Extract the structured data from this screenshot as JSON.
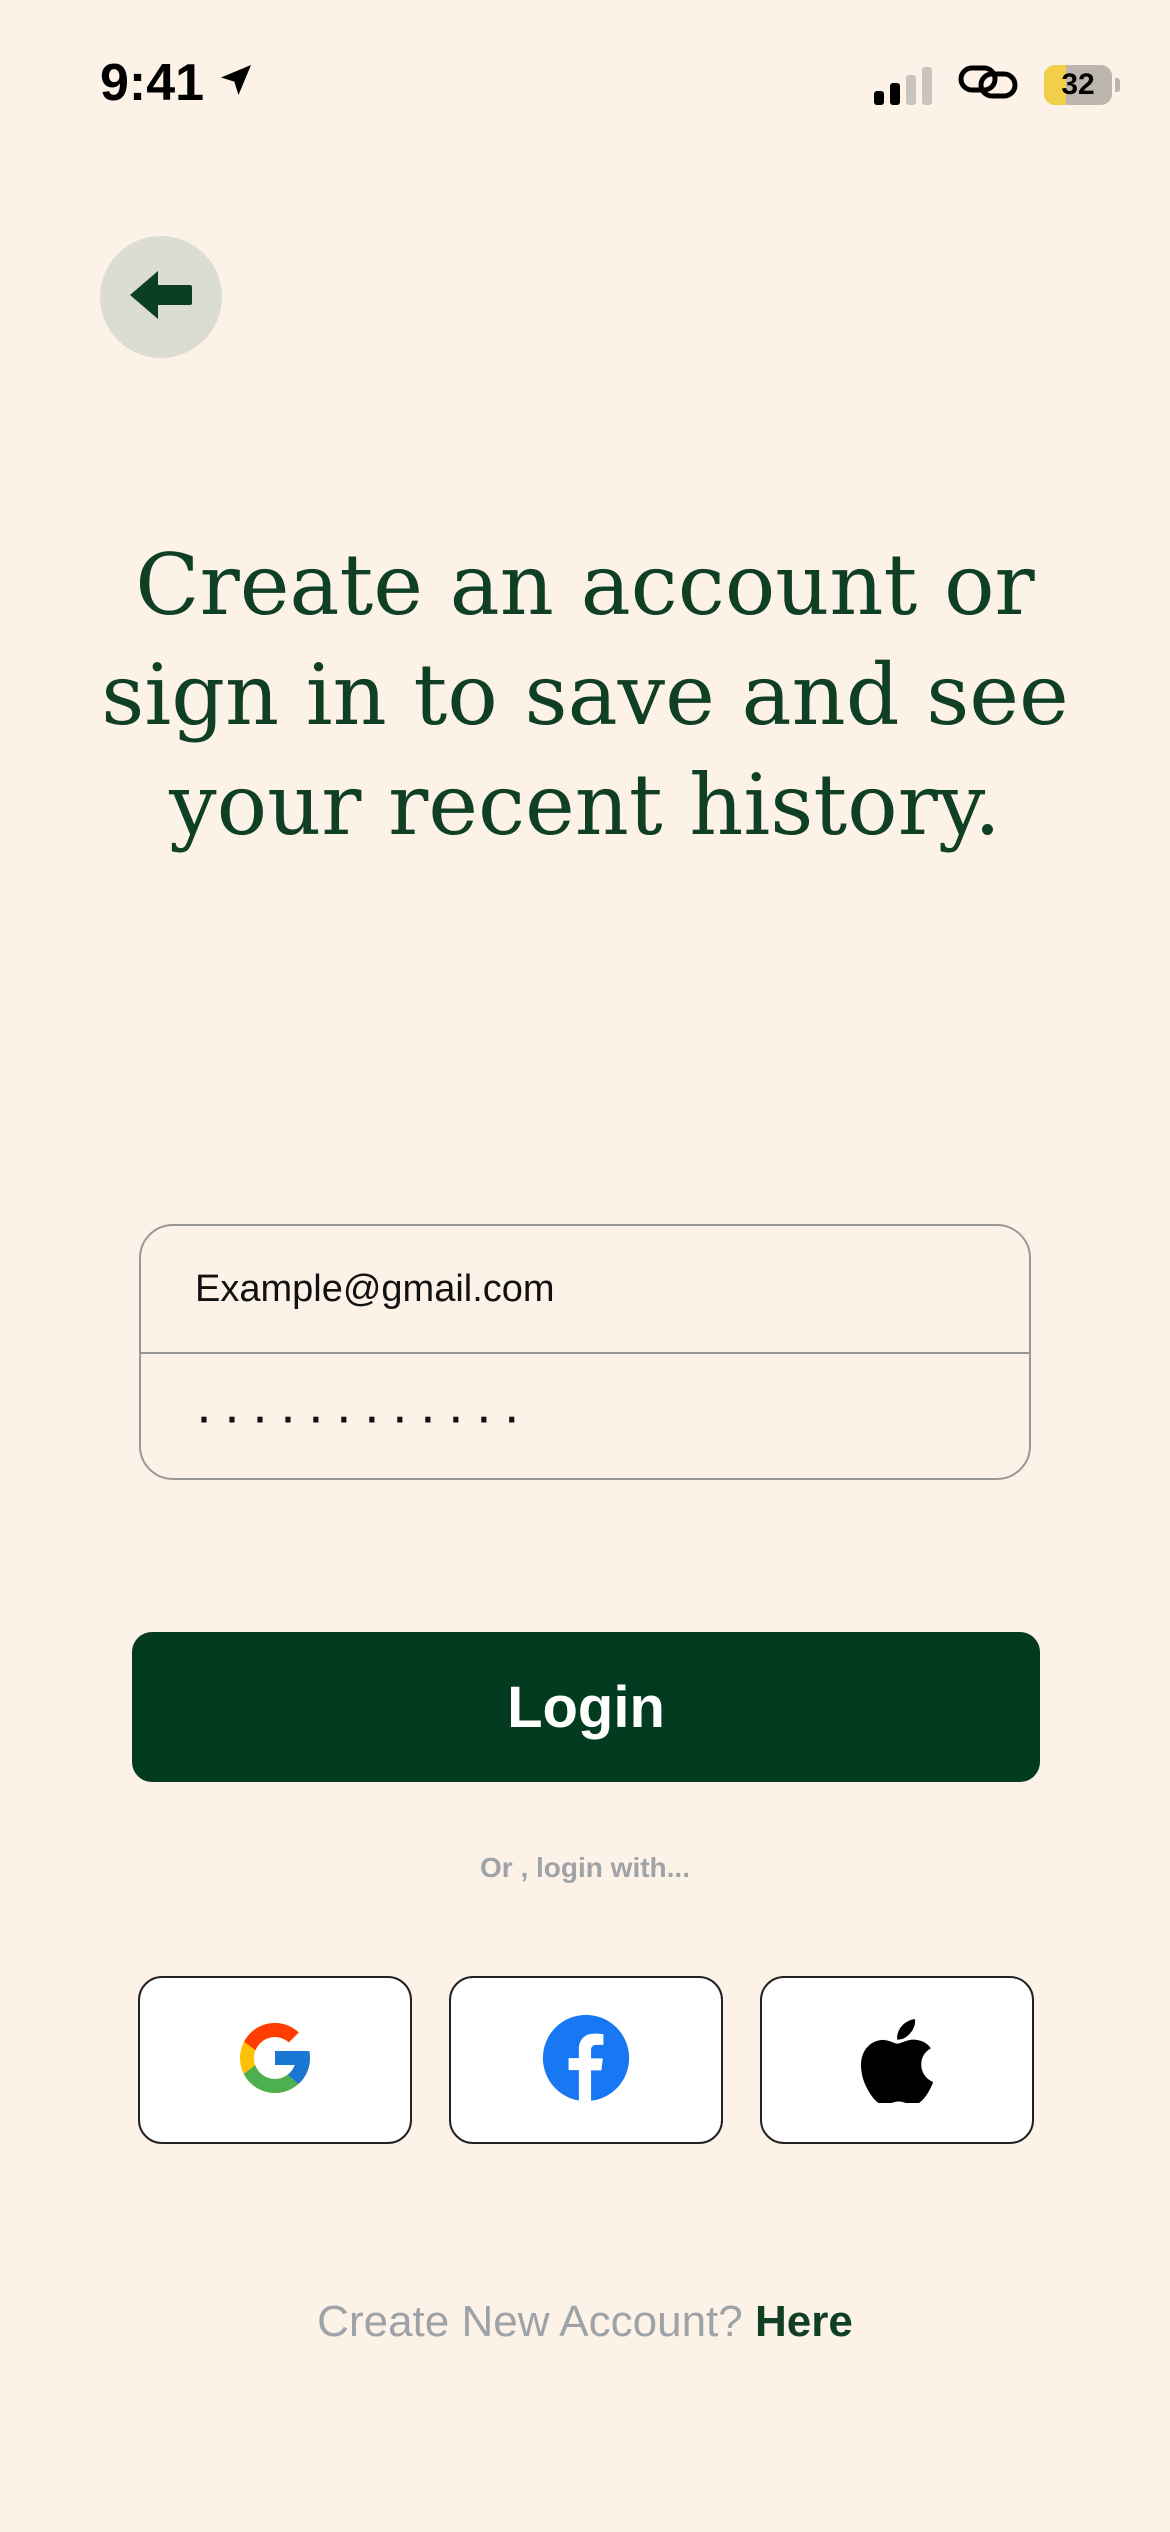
{
  "status_bar": {
    "time": "9:41",
    "battery_level": "32",
    "icons": [
      "location-arrow-icon",
      "signal-bars-icon",
      "link-icon",
      "battery-icon"
    ]
  },
  "header": {
    "back_icon": "arrow-left-icon"
  },
  "headline": "Create an account or sign in to save and see your recent history.",
  "form": {
    "email_value": "Example@gmail.com",
    "password_value": "············"
  },
  "login_button_label": "Login",
  "alt_login_text": "Or , login with...",
  "social": [
    {
      "name": "Google",
      "icon": "google-icon"
    },
    {
      "name": "Facebook",
      "icon": "facebook-icon"
    },
    {
      "name": "Apple",
      "icon": "apple-icon"
    }
  ],
  "footer": {
    "prompt": "Create New Account?",
    "link_label": "Here"
  },
  "colors": {
    "background": "#fcf2e8",
    "primary": "#033b20",
    "headline": "#0f4024",
    "muted": "#9ea3a8"
  }
}
